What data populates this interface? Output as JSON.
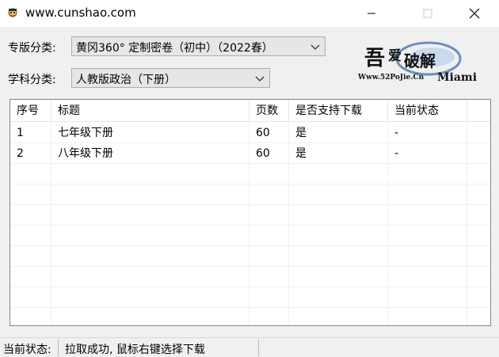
{
  "window": {
    "title": "www.cunshao.com",
    "icon": "app-mascot-icon"
  },
  "form": {
    "edition_label": "专版分类:",
    "edition_value": "黄冈360° 定制密卷（初中）（2022春）",
    "subject_label": "学科分类:",
    "subject_value": "人教版政治（下册）"
  },
  "table": {
    "columns": [
      "序号",
      "标题",
      "页数",
      "是否支持下载",
      "当前状态"
    ],
    "rows": [
      [
        "1",
        "七年级下册",
        "60",
        "是",
        "-"
      ],
      [
        "2",
        "八年级下册",
        "60",
        "是",
        "-"
      ]
    ]
  },
  "status": {
    "label": "当前状态:",
    "text": "拉取成功, 鼠标右键选择下载"
  },
  "colors": {
    "logo_ring": "#3c6fb4",
    "list_border": "#828790"
  }
}
